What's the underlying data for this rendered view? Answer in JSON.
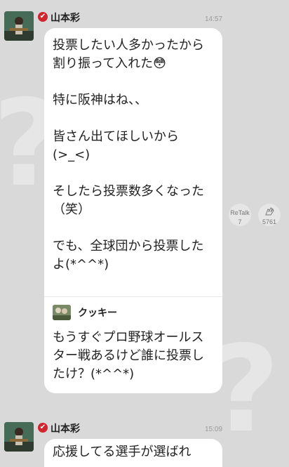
{
  "posts": [
    {
      "author": "山本彩",
      "time": "14:57",
      "message": "投票したい人多かったから\n割り振って入れた😳\n\n特に阪神はね、、\n\n皆さん出てほしいから\n(>_<)\n\nそしたら投票数多くなった（笑）\n\nでも、全球団から投票したよ(*^^*)",
      "quote": {
        "author": "クッキー",
        "text": "もうすぐプロ野球オールスター戦あるけど誰に投票したけ？(*^^*)"
      },
      "retalk": {
        "label": "ReTalk",
        "count": "7"
      },
      "clap": {
        "icon": "clap-icon",
        "count": "5761"
      }
    },
    {
      "author": "山本彩",
      "time": "15:09",
      "message_partial": "応援してる選手が選ばれ"
    }
  ],
  "colors": {
    "background": "#d9d9d9",
    "bubble": "#ffffff",
    "verified": "#d0262d"
  }
}
